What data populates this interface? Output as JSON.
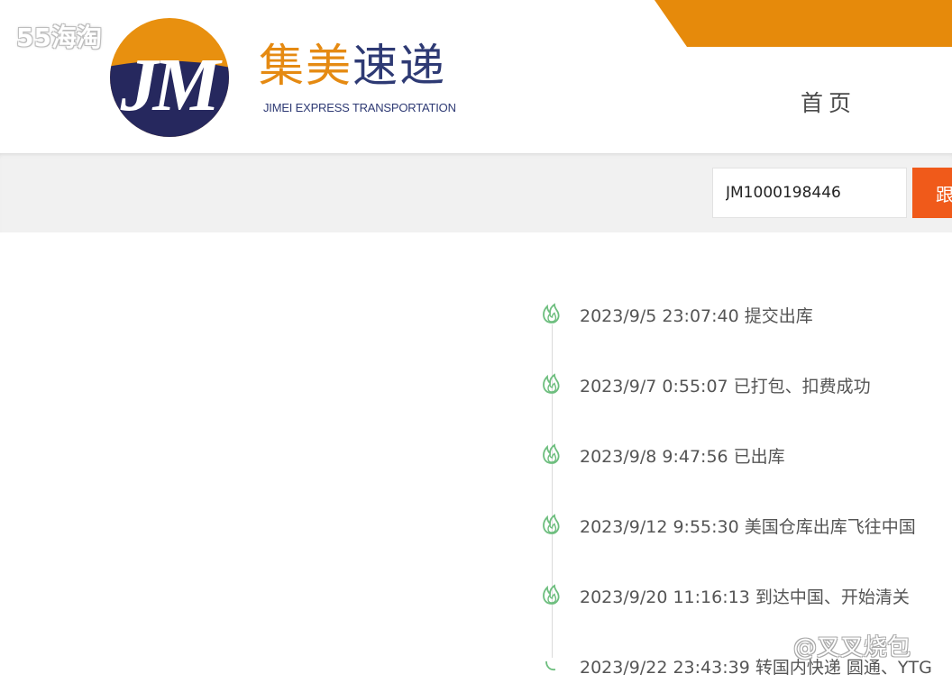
{
  "watermark": {
    "top_left": "55海淘",
    "bottom_right": "@叉叉烧包"
  },
  "brand": {
    "cn_part1": "集美",
    "cn_part2": "速递",
    "en": "JIMEI   EXPRESS TRANSPORTATION",
    "logo_icon": "jm-logo-icon",
    "logo_letters": "JM"
  },
  "nav": {
    "home": "首页"
  },
  "search": {
    "tracking_number": "JM1000198446",
    "button_label": "跟"
  },
  "timeline": [
    {
      "text": "2023/9/5 23:07:40 提交出库",
      "icon": "flame-icon"
    },
    {
      "text": "2023/9/7 0:55:07 已打包、扣费成功",
      "icon": "flame-icon"
    },
    {
      "text": "2023/9/8 9:47:56 已出库",
      "icon": "flame-icon"
    },
    {
      "text": "2023/9/12 9:55:30 美国仓库出库飞往中国",
      "icon": "flame-icon"
    },
    {
      "text": "2023/9/20 11:16:13 到达中国、开始清关",
      "icon": "flame-icon"
    },
    {
      "text": "2023/9/22 23:43:39 转国内快递 圆通、YTG",
      "icon": "arc-icon"
    }
  ],
  "colors": {
    "brand_orange": "#E58A12",
    "brand_navy": "#2E3A74",
    "button_orange": "#F05A1A",
    "timeline_green": "#6DBE7E"
  }
}
